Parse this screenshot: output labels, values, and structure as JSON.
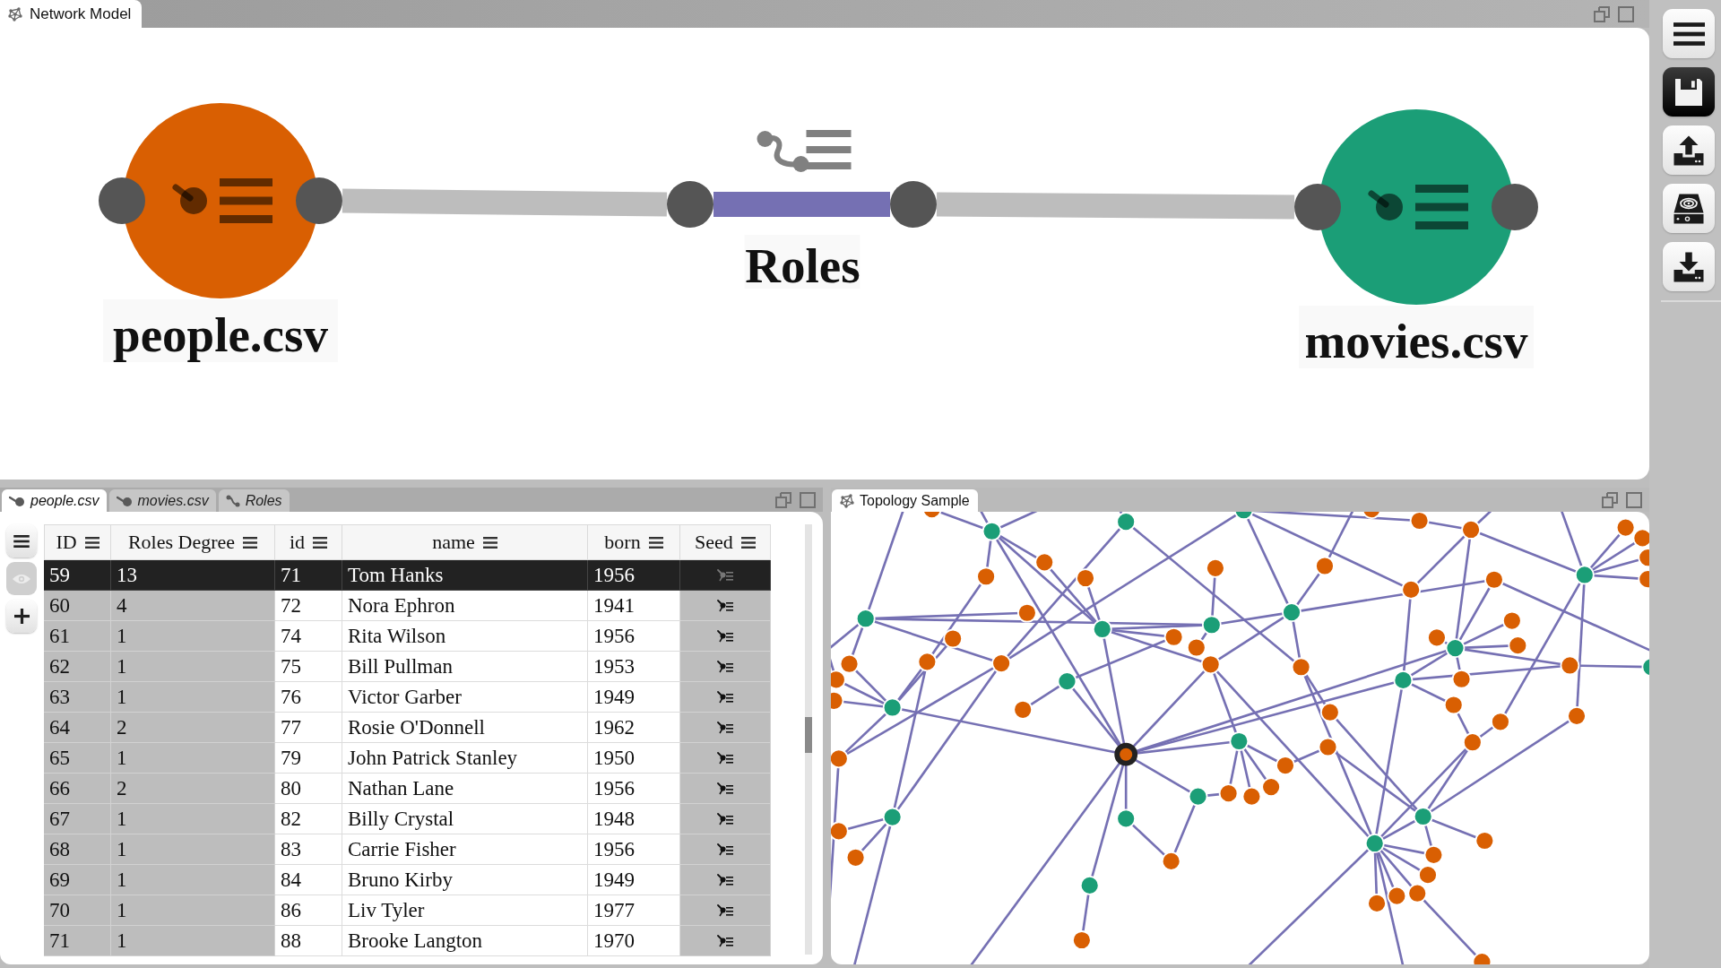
{
  "model_panel": {
    "tab": "Network Model",
    "nodes": [
      {
        "label": "people.csv",
        "color": "#d95f02"
      },
      {
        "label": "movies.csv",
        "color": "#1b9e77"
      }
    ],
    "edges": [
      {
        "label": "Roles"
      }
    ]
  },
  "toolbar": [
    {
      "kind": "menu",
      "active": false
    },
    {
      "kind": "save",
      "active": true
    },
    {
      "kind": "upload",
      "active": false
    },
    {
      "kind": "drive",
      "active": false
    },
    {
      "kind": "download",
      "active": false
    }
  ],
  "table_panel": {
    "tabs": [
      {
        "label": "people.csv",
        "kind": "node",
        "selected": true
      },
      {
        "label": "movies.csv",
        "kind": "node",
        "selected": false
      },
      {
        "label": "Roles",
        "kind": "edge",
        "selected": false
      }
    ],
    "tools": [
      {
        "kind": "menu",
        "disabled": false
      },
      {
        "kind": "view",
        "disabled": true
      },
      {
        "kind": "add",
        "disabled": false
      }
    ],
    "columns": [
      {
        "label": "ID",
        "kind": "meta"
      },
      {
        "label": "Roles Degree",
        "kind": "meta"
      },
      {
        "label": "id",
        "kind": "property"
      },
      {
        "label": "name",
        "kind": "property"
      },
      {
        "label": "born",
        "kind": "property"
      },
      {
        "label": "Seed",
        "kind": "seed"
      }
    ],
    "rows": [
      {
        "cells": [
          "59",
          "13",
          "71",
          "Tom Hanks",
          "1956"
        ],
        "selected": true
      },
      {
        "cells": [
          "60",
          "4",
          "72",
          "Nora Ephron",
          "1941"
        ],
        "selected": false
      },
      {
        "cells": [
          "61",
          "1",
          "74",
          "Rita Wilson",
          "1956"
        ],
        "selected": false
      },
      {
        "cells": [
          "62",
          "1",
          "75",
          "Bill Pullman",
          "1953"
        ],
        "selected": false
      },
      {
        "cells": [
          "63",
          "1",
          "76",
          "Victor Garber",
          "1949"
        ],
        "selected": false
      },
      {
        "cells": [
          "64",
          "2",
          "77",
          "Rosie O'Donnell",
          "1962"
        ],
        "selected": false
      },
      {
        "cells": [
          "65",
          "1",
          "79",
          "John Patrick Stanley",
          "1950"
        ],
        "selected": false
      },
      {
        "cells": [
          "66",
          "2",
          "80",
          "Nathan Lane",
          "1956"
        ],
        "selected": false
      },
      {
        "cells": [
          "67",
          "1",
          "82",
          "Billy Crystal",
          "1948"
        ],
        "selected": false
      },
      {
        "cells": [
          "68",
          "1",
          "83",
          "Carrie Fisher",
          "1956"
        ],
        "selected": false
      },
      {
        "cells": [
          "69",
          "1",
          "84",
          "Bruno Kirby",
          "1949"
        ],
        "selected": false
      },
      {
        "cells": [
          "70",
          "1",
          "86",
          "Liv Tyler",
          "1977"
        ],
        "selected": false
      },
      {
        "cells": [
          "71",
          "1",
          "88",
          "Brooke Langton",
          "1970"
        ],
        "selected": false
      }
    ]
  },
  "topology_panel": {
    "tab": "Topology Sample"
  }
}
